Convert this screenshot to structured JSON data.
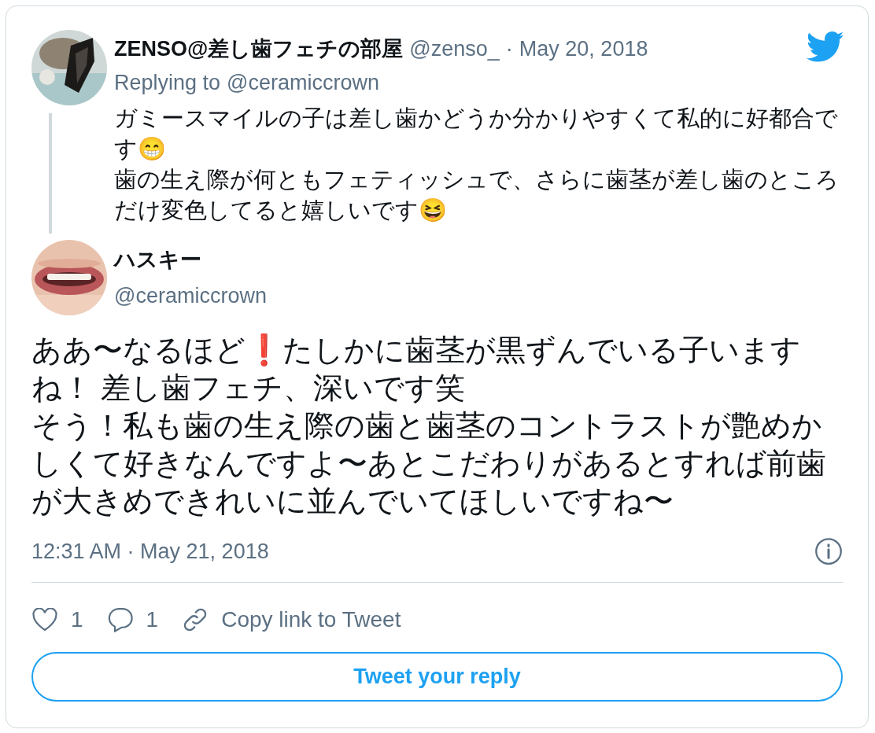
{
  "parent_tweet": {
    "author_name": "ZENSO@差し歯フェチの部屋",
    "handle": "@zenso_",
    "separator": "·",
    "date": "May 20, 2018",
    "replying_label": "Replying to",
    "replying_to": "@ceramiccrown",
    "paragraphs": [
      "ガミースマイルの子は差し歯かどうか分かりやすくて私的に好都合です😁",
      "歯の生え際が何ともフェティッシュで、さらに歯茎が差し歯のところだけ変色してると嬉しいです😆"
    ]
  },
  "tweet": {
    "author_name": "ハスキー",
    "handle": "@ceramiccrown",
    "paragraphs": [
      "ああ〜なるほど❗たしかに歯茎が黒ずんでいる子いますね！ 差し歯フェチ、深いです笑",
      "そう！私も歯の生え際の歯と歯茎のコントラストが艶めかしくて好きなんですよ〜あとこだわりがあるとすれば前歯が大きめできれいに並んでいてほしいですね〜"
    ],
    "timestamp": "12:31 AM · May 21, 2018"
  },
  "actions": [
    {
      "kind": "like",
      "count": "1"
    },
    {
      "kind": "reply",
      "count": "1"
    },
    {
      "kind": "link",
      "label": "Copy link to Tweet"
    }
  ],
  "reply_button": "Tweet your reply"
}
